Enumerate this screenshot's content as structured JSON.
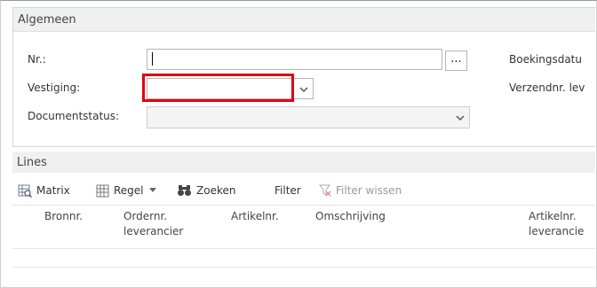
{
  "general": {
    "title": "Algemeen",
    "fields": {
      "nr": {
        "label": "Nr.:",
        "value": "",
        "assist_label": "..."
      },
      "vestiging": {
        "label": "Vestiging:",
        "value": ""
      },
      "documentstatus": {
        "label": "Documentstatus:",
        "value": ""
      },
      "boekingsdatum": {
        "label": "Boekingsdatu"
      },
      "verzendnr": {
        "label": "Verzendnr. lev"
      }
    }
  },
  "lines": {
    "title": "Lines",
    "toolbar": {
      "matrix": "Matrix",
      "regel": "Regel",
      "zoeken": "Zoeken",
      "filter": "Filter",
      "filter_wissen": "Filter wissen"
    },
    "columns": {
      "bronnr": "Bronnr.",
      "ordernr_1": "Ordernr.",
      "ordernr_2": "leverancier",
      "artikelnr": "Artikelnr.",
      "omschrijving": "Omschrijving",
      "artikelnr_lev_1": "Artikelnr.",
      "artikelnr_lev_2": "leverancie"
    }
  },
  "colors": {
    "highlight": "#e0000f",
    "section_header_bg": "#f0f0f0",
    "input_border": "#b5b5b5"
  }
}
